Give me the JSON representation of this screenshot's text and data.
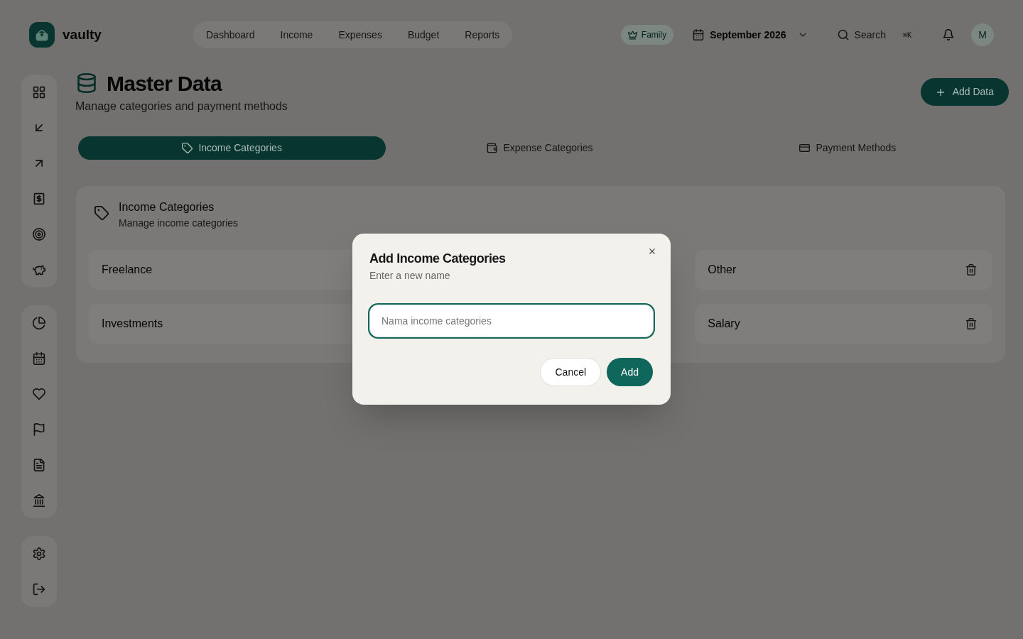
{
  "brand": {
    "name": "vaulty"
  },
  "top_nav": {
    "links": [
      {
        "label": "Dashboard",
        "selected": false
      },
      {
        "label": "Income",
        "selected": false
      },
      {
        "label": "Expenses",
        "selected": false
      },
      {
        "label": "Budget",
        "selected": false
      },
      {
        "label": "Reports",
        "selected": false
      }
    ]
  },
  "toolbar": {
    "family": {
      "label": "Family"
    },
    "period": {
      "label": "September 2026"
    },
    "search": {
      "label": "Search",
      "shortcut": "⌘K"
    },
    "avatar": {
      "initial": "M"
    }
  },
  "sidebar": {
    "groups": [
      {
        "items": [
          {
            "selected": false
          },
          {
            "selected": false
          },
          {
            "selected": false
          },
          {
            "selected": false
          },
          {
            "selected": false
          },
          {
            "selected": false
          }
        ]
      },
      {
        "items": [
          {
            "selected": false
          },
          {
            "selected": false
          },
          {
            "selected": false
          },
          {
            "selected": false
          },
          {
            "selected": false
          },
          {
            "selected": false
          }
        ]
      },
      {
        "items": [
          {
            "selected": false
          },
          {
            "selected": false
          }
        ]
      }
    ]
  },
  "page": {
    "title": "Master Data",
    "subtitle": "Manage categories and payment methods",
    "action": "Add Data"
  },
  "tabs": [
    {
      "label": "Income Categories",
      "selected": true
    },
    {
      "label": "Expense Categories",
      "selected": false
    },
    {
      "label": "Payment Methods",
      "selected": false
    }
  ],
  "card": {
    "title": "Income Categories",
    "subtitle": "Manage income categories",
    "items": [
      {
        "name": "Freelance"
      },
      {
        "name": "Other"
      },
      {
        "name": "Investments"
      },
      {
        "name": "Salary"
      }
    ]
  },
  "dialog": {
    "title": "Add Income Categories",
    "subtitle": "Enter a new name",
    "field": {
      "placeholder": "Nama income categories"
    },
    "buttons": [
      {
        "label": "Cancel",
        "kind": "secondary"
      },
      {
        "label": "Add",
        "kind": "primary"
      }
    ]
  }
}
